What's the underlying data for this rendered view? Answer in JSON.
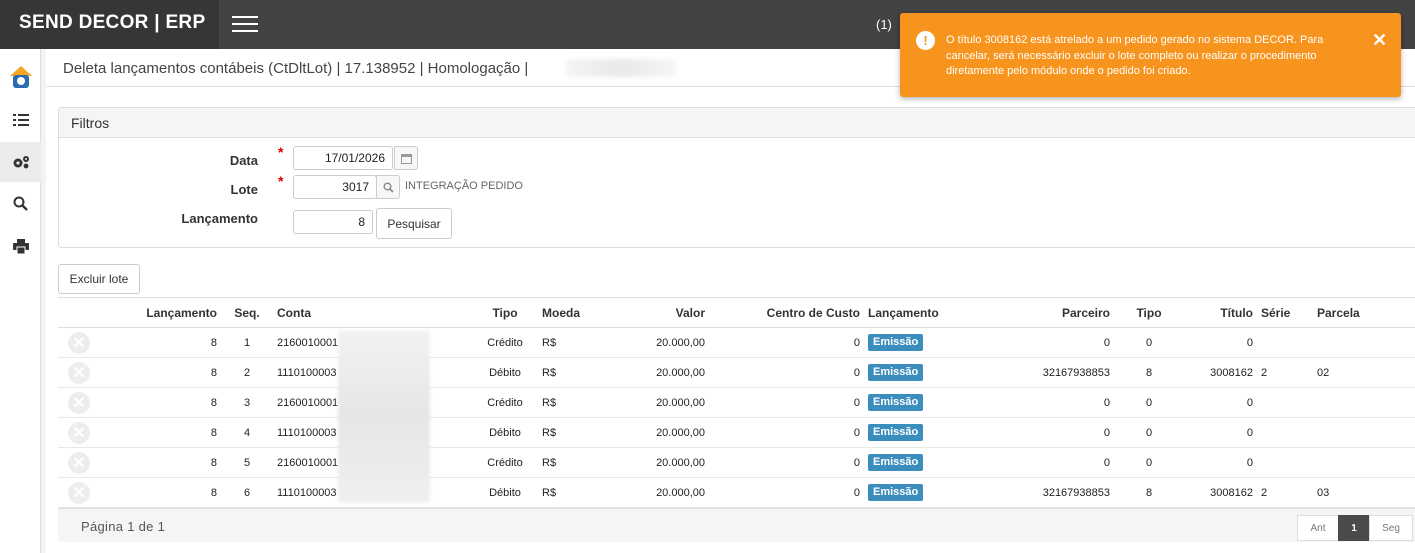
{
  "app": {
    "title": "SEND DECOR | ERP",
    "notification_count": "(1)"
  },
  "header": {
    "title": "Deleta lançamentos contábeis (CtDltLot) | 17.138952 | Homologação |"
  },
  "filters": {
    "panel_title": "Filtros",
    "data_label": "Data",
    "data_value": "17/01/2026",
    "lote_label": "Lote",
    "lote_value": "3017",
    "lote_desc": "INTEGRAÇÃO PEDIDO",
    "lancamento_label": "Lançamento",
    "lancamento_value": "8",
    "required_mark": "*",
    "search_button": "Pesquisar"
  },
  "actions": {
    "delete_lot": "Excluir lote"
  },
  "table": {
    "columns": [
      "Lançamento",
      "Seq.",
      "Conta",
      "Tipo",
      "Moeda",
      "Valor",
      "Centro de Custo",
      "Lançamento",
      "Parceiro",
      "Tipo",
      "Título",
      "Série",
      "Parcela"
    ],
    "rows": [
      {
        "lanc": "8",
        "seq": "1",
        "conta": "2160010001",
        "tipo": "Crédito",
        "moeda": "R$",
        "valor": "20.000,00",
        "cc": "0",
        "lancamento": "Emissão",
        "parceiro": "0",
        "tipo2": "0",
        "titulo": "0",
        "serie": "",
        "parcela": ""
      },
      {
        "lanc": "8",
        "seq": "2",
        "conta": "1110100003",
        "tipo": "Débito",
        "moeda": "R$",
        "valor": "20.000,00",
        "cc": "0",
        "lancamento": "Emissão",
        "parceiro": "32167938853",
        "tipo2": "8",
        "titulo": "3008162",
        "serie": "2",
        "parcela": "02"
      },
      {
        "lanc": "8",
        "seq": "3",
        "conta": "2160010001",
        "tipo": "Crédito",
        "moeda": "R$",
        "valor": "20.000,00",
        "cc": "0",
        "lancamento": "Emissão",
        "parceiro": "0",
        "tipo2": "0",
        "titulo": "0",
        "serie": "",
        "parcela": ""
      },
      {
        "lanc": "8",
        "seq": "4",
        "conta": "1110100003",
        "tipo": "Débito",
        "moeda": "R$",
        "valor": "20.000,00",
        "cc": "0",
        "lancamento": "Emissão",
        "parceiro": "0",
        "tipo2": "0",
        "titulo": "0",
        "serie": "",
        "parcela": ""
      },
      {
        "lanc": "8",
        "seq": "5",
        "conta": "2160010001",
        "tipo": "Crédito",
        "moeda": "R$",
        "valor": "20.000,00",
        "cc": "0",
        "lancamento": "Emissão",
        "parceiro": "0",
        "tipo2": "0",
        "titulo": "0",
        "serie": "",
        "parcela": ""
      },
      {
        "lanc": "8",
        "seq": "6",
        "conta": "1110100003",
        "tipo": "Débito",
        "moeda": "R$",
        "valor": "20.000,00",
        "cc": "0",
        "lancamento": "Emissão",
        "parceiro": "32167938853",
        "tipo2": "8",
        "titulo": "3008162",
        "serie": "2",
        "parcela": "03"
      }
    ]
  },
  "pagination": {
    "text": "Página 1 de 1",
    "prev": "Ant",
    "current": "1",
    "next": "Seg"
  },
  "toast": {
    "message": "O título 3008162 está atrelado a um pedido gerado no sistema DECOR. Para cancelar, será necessário excluir o lote completo ou realizar o procedimento diretamente pelo módulo onde o pedido foi criado.",
    "close": "✕",
    "icon": "exclamation-icon"
  },
  "colors": {
    "toast": "#f7941d",
    "topbar": "#434343",
    "badge": "#3b8dbd"
  }
}
